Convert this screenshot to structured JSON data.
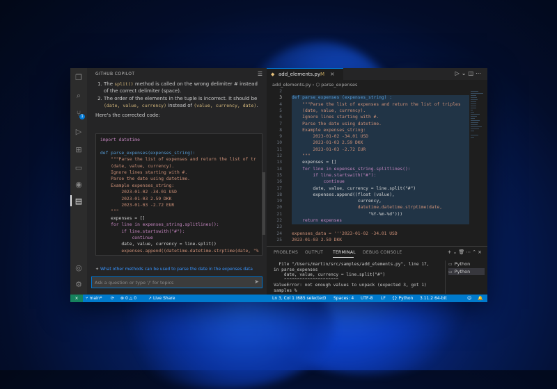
{
  "sidebar": {
    "title": "GITHUB COPILOT",
    "chat": {
      "item1_pre": "The ",
      "item1_code": "split()",
      "item1_post": " method is called on the wrong delimiter # instead of the correct delimiter (space).",
      "item2_pre": "The order of the elements in the tuple is incorrect. It should be ",
      "item2_code": "(date, value, currency)",
      "item2_mid": " instead of ",
      "item2_code2": "(value, currency, date)",
      "item2_post": ".",
      "intro": "Here's the corrected code:"
    },
    "code_lines": [
      "import datetime",
      "",
      "def parse_expenses(expenses_string):",
      "    \"\"\"Parse the list of expenses and return the list of tr",
      "    (date, value, currency).",
      "    Ignore lines starting with #.",
      "    Parse the date using datetime.",
      "    Example expenses_string:",
      "        2023-01-02 -34.01 USD",
      "        2023-01-03 2.59 DKK",
      "        2023-01-03 -2.72 EUR",
      "    \"\"\"",
      "    expenses = []",
      "    for line in expenses_string.splitlines():",
      "        if line.startswith(\"#\"):",
      "            continue",
      "        date, value, currency = line.split()",
      "        expenses.append((datetime.datetime.strptime(date, \"%"
    ],
    "suggestion": "What other methods can be used to parse the date in the expenses data",
    "ask_placeholder": "Ask a question or type '/' for topics"
  },
  "editor": {
    "tab_name": "add_elements.py",
    "tab_modified": "M",
    "breadcrumb_file": "add_elements.py",
    "breadcrumb_symbol": "parse_expenses",
    "line_numbers": [
      "2",
      "3",
      "4",
      "5",
      "6",
      "7",
      "8",
      "9",
      "10",
      "11",
      "12",
      "13",
      "14",
      "15",
      "16",
      "17",
      "18",
      "19",
      "20",
      "21",
      "22",
      "23",
      "24",
      "25"
    ],
    "code_lines": [
      "",
      "def parse_expenses (expenses_string) :",
      "    \"\"\"Parse the list of expenses and return the list of triples",
      "    (date, value, currency).",
      "    Ignore lines starting with #.",
      "    Parse the date using datetime.",
      "    Example expenses_string:",
      "        2023-01-02 -34.01 USD",
      "        2023-01-03 2.59 DKK",
      "        2023-01-03 -2.72 EUR",
      "    \"\"\"",
      "    expenses = []",
      "    for line in expenses_string.splitlines():",
      "        if line.startswith(\"#\"):",
      "            continue",
      "        date, value, currency = line.split(\"#\")",
      "        expenses.append((float (value),",
      "                         currency,",
      "                         datetime.datetime.strptime(date,",
      "                             \"%Y-%m-%d\")))",
      "    return expenses",
      "",
      "expenses_data = '''2023-01-02 -34.01 USD",
      "2023-01-03 2.59 DKK"
    ]
  },
  "panel": {
    "tabs": [
      "PROBLEMS",
      "OUTPUT",
      "TERMINAL",
      "DEBUG CONSOLE"
    ],
    "terminal_lines": [
      "  File \"/Users/martin/src/samples/add_elements.py\", line 17,",
      "in parse_expenses",
      "    date, value, currency = line.split(\"#\")",
      "    ^^^^^^^^^^^^^^^^^^^^^",
      "ValueError: not enough values to unpack (expected 3, got 1)",
      "samples %"
    ],
    "terminals": [
      "Python",
      "Python"
    ]
  },
  "statusbar": {
    "branch": "main*",
    "sync": "⟳",
    "errors": "0",
    "warnings": "0",
    "live_share": "Live Share",
    "position": "Ln 3, Col 1 (685 selected)",
    "spaces": "Spaces: 4",
    "encoding": "UTF-8",
    "eol": "LF",
    "language": "Python",
    "interpreter": "3.11.2 64-bit"
  },
  "colors": {
    "accent": "#007acc",
    "selection": "#264f78"
  }
}
